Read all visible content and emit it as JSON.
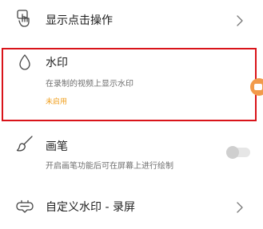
{
  "settings": {
    "show_click": {
      "title": "显示点击操作",
      "icon": "tap-hand-icon"
    },
    "watermark": {
      "title": "水印",
      "subtitle": "在录制的视频上显示水印",
      "status": "未启用",
      "icon": "water-drop-icon",
      "enabled": true
    },
    "brush": {
      "title": "画笔",
      "subtitle": "开启画笔功能后可在屏幕上进行绘制",
      "icon": "brush-icon",
      "enabled": false
    },
    "custom_watermark": {
      "title": "自定义水印 - 录屏",
      "icon": "watermark-badge-icon"
    }
  },
  "colors": {
    "accent": "#f29a4a",
    "status_text": "#f0a020",
    "highlight_border": "#d9141a"
  }
}
